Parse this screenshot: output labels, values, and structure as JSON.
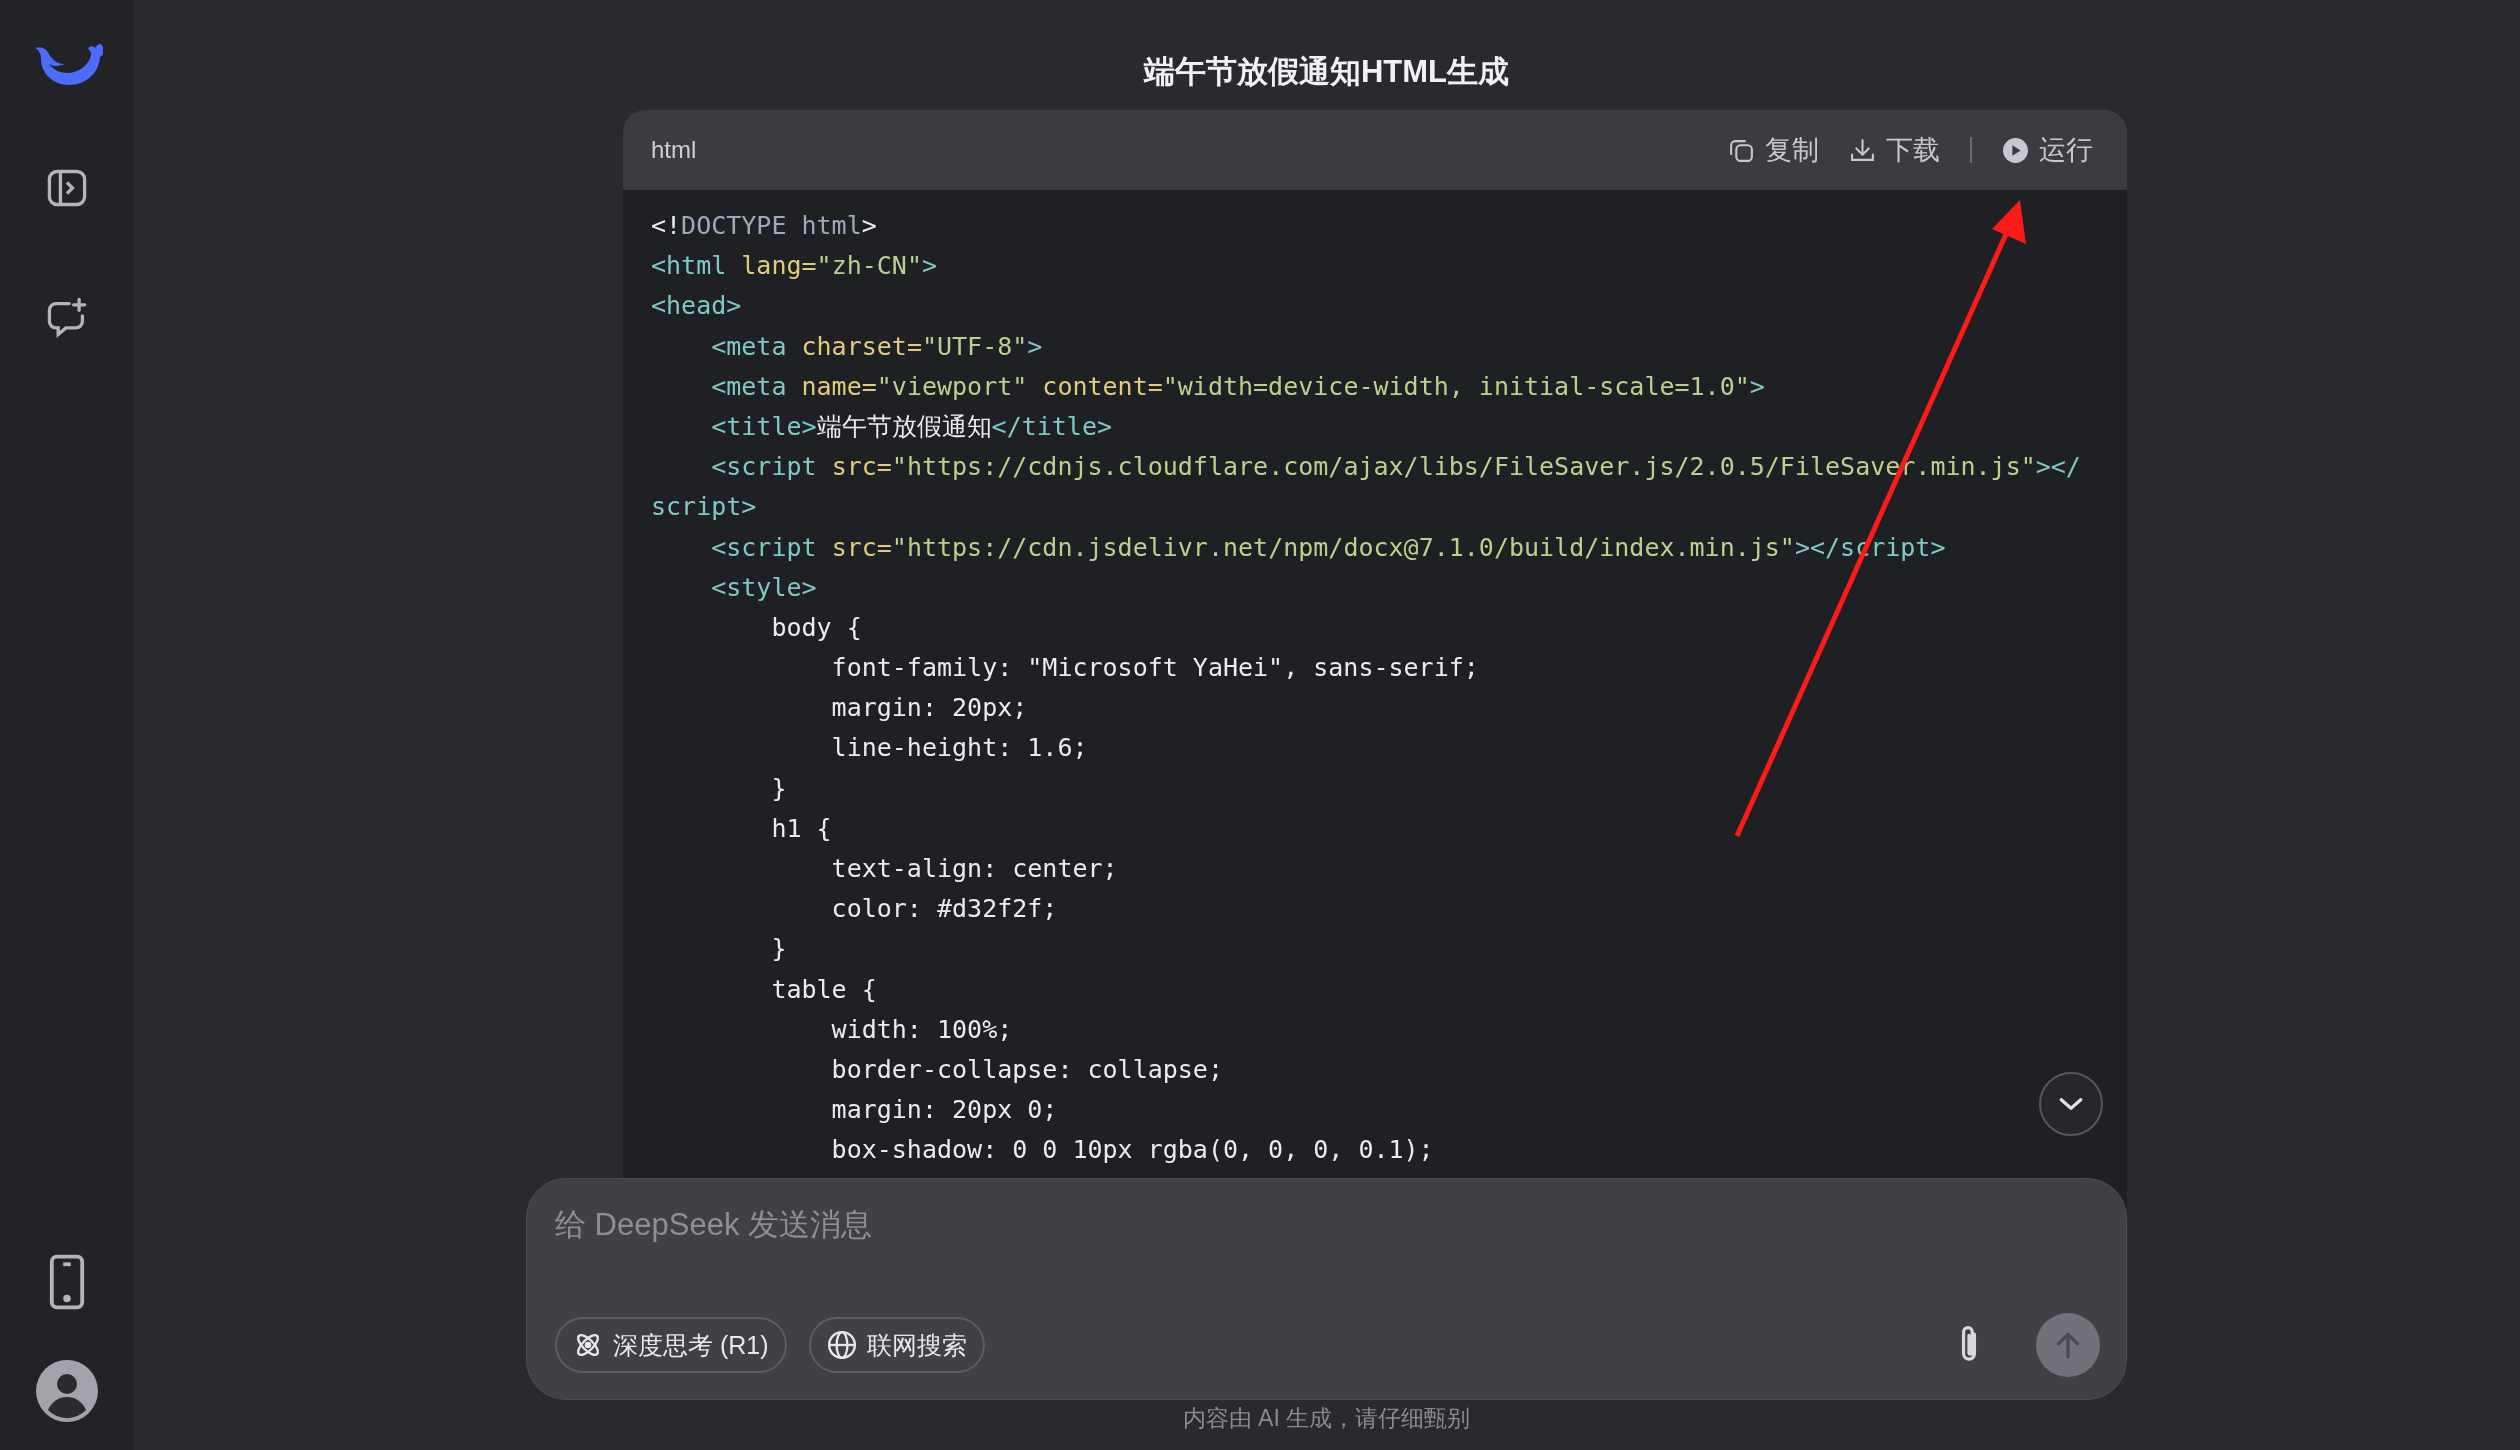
{
  "conversation": {
    "title": "端午节放假通知HTML生成"
  },
  "code_block": {
    "language": "html",
    "actions": [
      {
        "kind": "copy",
        "label": "复制"
      },
      {
        "kind": "download",
        "label": "下载"
      },
      {
        "kind": "run",
        "label": "运行"
      }
    ],
    "lines": [
      {
        "tokens": [
          {
            "kind": "plain",
            "text": "<!"
          },
          {
            "kind": "doctype",
            "text": "DOCTYPE html"
          },
          {
            "kind": "plain",
            "text": ">"
          }
        ]
      },
      {
        "tokens": [
          {
            "kind": "tag",
            "text": "<html"
          },
          {
            "kind": "attr",
            "text": " lang="
          },
          {
            "kind": "string",
            "text": "\"zh-CN\""
          },
          {
            "kind": "tag",
            "text": ">"
          }
        ]
      },
      {
        "tokens": [
          {
            "kind": "tag",
            "text": "<head>"
          }
        ]
      },
      {
        "tokens": [
          {
            "kind": "tag",
            "text": "    <meta"
          },
          {
            "kind": "attr",
            "text": " charset="
          },
          {
            "kind": "string",
            "text": "\"UTF-8\""
          },
          {
            "kind": "tag",
            "text": ">"
          }
        ]
      },
      {
        "tokens": [
          {
            "kind": "tag",
            "text": "    <meta"
          },
          {
            "kind": "attr",
            "text": " name="
          },
          {
            "kind": "string",
            "text": "\"viewport\""
          },
          {
            "kind": "attr",
            "text": " content="
          },
          {
            "kind": "string",
            "text": "\"width=device-width, initial-scale=1.0\""
          },
          {
            "kind": "tag",
            "text": ">"
          }
        ]
      },
      {
        "tokens": [
          {
            "kind": "tag",
            "text": "    <title>"
          },
          {
            "kind": "plain",
            "text": "端午节放假通知"
          },
          {
            "kind": "tag",
            "text": "</title>"
          }
        ]
      },
      {
        "tokens": [
          {
            "kind": "tag",
            "text": "    <script"
          },
          {
            "kind": "attr",
            "text": " src="
          },
          {
            "kind": "string",
            "text": "\"https://cdnjs.cloudflare.com/ajax/libs/FileSaver.js/2.0.5/FileSaver.min.js\""
          },
          {
            "kind": "tag",
            "text": "></"
          }
        ]
      },
      {
        "tokens": [
          {
            "kind": "tag",
            "text": "script>"
          }
        ]
      },
      {
        "tokens": [
          {
            "kind": "tag",
            "text": "    <script"
          },
          {
            "kind": "attr",
            "text": " src="
          },
          {
            "kind": "string",
            "text": "\"https://cdn.jsdelivr.net/npm/docx@7.1.0/build/index.min.js\""
          },
          {
            "kind": "tag",
            "text": "></script>"
          }
        ]
      },
      {
        "tokens": [
          {
            "kind": "tag",
            "text": "    <style>"
          }
        ]
      },
      {
        "tokens": [
          {
            "kind": "plain",
            "text": "        body {"
          }
        ]
      },
      {
        "tokens": [
          {
            "kind": "plain",
            "text": "            font-family: \"Microsoft YaHei\", sans-serif;"
          }
        ]
      },
      {
        "tokens": [
          {
            "kind": "plain",
            "text": "            margin: 20px;"
          }
        ]
      },
      {
        "tokens": [
          {
            "kind": "plain",
            "text": "            line-height: 1.6;"
          }
        ]
      },
      {
        "tokens": [
          {
            "kind": "plain",
            "text": "        }"
          }
        ]
      },
      {
        "tokens": [
          {
            "kind": "plain",
            "text": "        h1 {"
          }
        ]
      },
      {
        "tokens": [
          {
            "kind": "plain",
            "text": "            text-align: center;"
          }
        ]
      },
      {
        "tokens": [
          {
            "kind": "plain",
            "text": "            color: #d32f2f;"
          }
        ]
      },
      {
        "tokens": [
          {
            "kind": "plain",
            "text": "        }"
          }
        ]
      },
      {
        "tokens": [
          {
            "kind": "plain",
            "text": "        table {"
          }
        ]
      },
      {
        "tokens": [
          {
            "kind": "plain",
            "text": "            width: 100%;"
          }
        ]
      },
      {
        "tokens": [
          {
            "kind": "plain",
            "text": "            border-collapse: collapse;"
          }
        ]
      },
      {
        "tokens": [
          {
            "kind": "plain",
            "text": "            margin: 20px 0;"
          }
        ]
      },
      {
        "tokens": [
          {
            "kind": "plain",
            "text": "            box-shadow: 0 0 10px rgba(0, 0, 0, 0.1);"
          }
        ]
      }
    ]
  },
  "composer": {
    "placeholder": "给 DeepSeek 发送消息",
    "toggles": [
      {
        "kind": "deep-think",
        "label": "深度思考 (R1)",
        "selected": false
      },
      {
        "kind": "web-search",
        "label": "联网搜索",
        "selected": false
      }
    ]
  },
  "footer_note": "内容由 AI 生成，请仔细甄别"
}
